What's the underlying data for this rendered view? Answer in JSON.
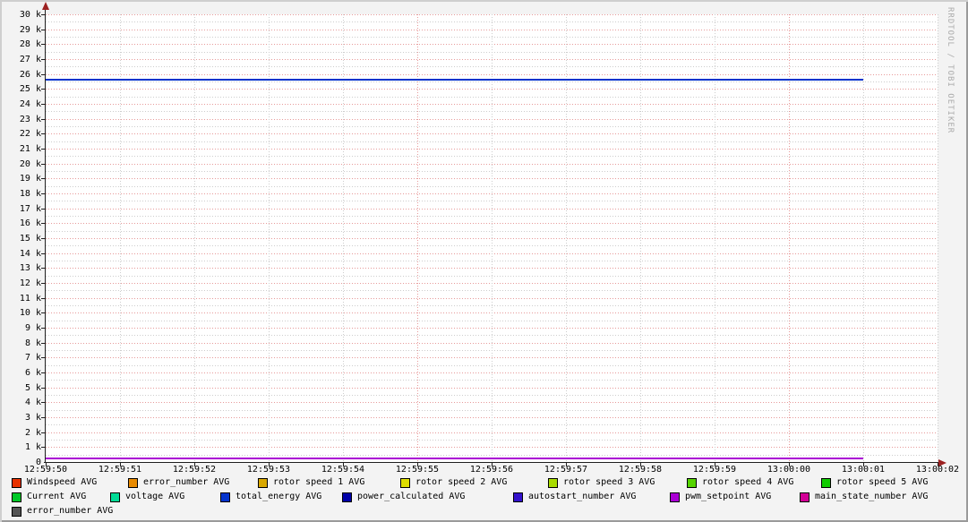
{
  "watermark": "RRDTOOL / TOBI OETIKER",
  "chart_data": {
    "type": "line",
    "title": "",
    "xlabel": "",
    "ylabel": "",
    "grid": true,
    "legend_position": "bottom",
    "ylim": [
      0,
      30000
    ],
    "y_tick_step": 1000,
    "y_minor_step": 500,
    "y_tick_labels": [
      "30 k",
      "29 k",
      "28 k",
      "27 k",
      "26 k",
      "25 k",
      "24 k",
      "23 k",
      "22 k",
      "21 k",
      "20 k",
      "19 k",
      "18 k",
      "17 k",
      "16 k",
      "15 k",
      "14 k",
      "13 k",
      "12 k",
      "11 k",
      "10 k",
      "9 k",
      "8 k",
      "7 k",
      "6 k",
      "5 k",
      "4 k",
      "3 k",
      "2 k",
      "1 k",
      "0"
    ],
    "x_ticks": [
      "12:59:50",
      "12:59:51",
      "12:59:52",
      "12:59:53",
      "12:59:54",
      "12:59:55",
      "12:59:56",
      "12:59:57",
      "12:59:58",
      "12:59:59",
      "13:00:00",
      "13:00:01",
      "13:00:02"
    ],
    "x_major_every_seconds": 5,
    "data_x_start": "12:59:50",
    "data_x_end": "13:00:01",
    "grid_colors": {
      "major": "#e79a9a",
      "minor": "#cdcdcd"
    },
    "series": [
      {
        "name": "Windspeed AVG",
        "color": "#e83200",
        "value": 0
      },
      {
        "name": "error_number AVG",
        "color": "#e88a00",
        "value": 0
      },
      {
        "name": "rotor speed 1 AVG",
        "color": "#d9a800",
        "value": 0
      },
      {
        "name": "rotor speed 2 AVG",
        "color": "#dede00",
        "value": 0
      },
      {
        "name": "rotor speed 3 AVG",
        "color": "#a8dc00",
        "value": 0
      },
      {
        "name": "rotor speed 4 AVG",
        "color": "#55d400",
        "value": 0
      },
      {
        "name": "rotor speed 5 AVG",
        "color": "#10cc00",
        "value": 0
      },
      {
        "name": "Current AVG",
        "color": "#00c828",
        "value": 0
      },
      {
        "name": "voltage AVG",
        "color": "#00dc96",
        "value": 0
      },
      {
        "name": "total_energy AVG",
        "color": "#0433cc",
        "value": 25600
      },
      {
        "name": "power_calculated AVG",
        "color": "#0000a8",
        "value": 0
      },
      {
        "name": "autostart_number AVG",
        "color": "#3412cc",
        "value": 0
      },
      {
        "name": "pwm_setpoint AVG",
        "color": "#aa00d4",
        "value": 250
      },
      {
        "name": "main_state_number AVG",
        "color": "#d20096",
        "value": 0
      },
      {
        "name": "error_number AVG",
        "color": "#555555",
        "value": 0
      }
    ]
  }
}
